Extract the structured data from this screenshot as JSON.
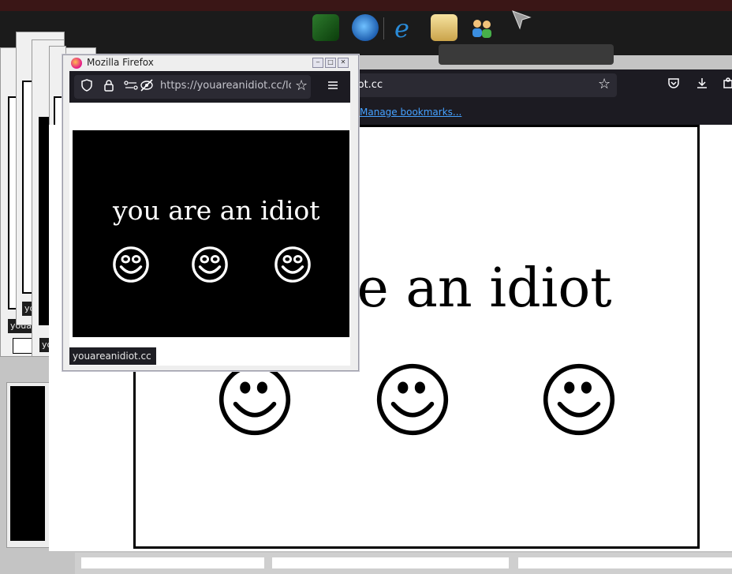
{
  "desktop": {
    "taskbar_icons": [
      "games-icon",
      "windows-update-icon",
      "internet-explorer-icon",
      "folder-mail-icon",
      "users-icon"
    ]
  },
  "background_window": {
    "url_fragment": "iot.cc",
    "bookmarks_link": "Manage bookmarks...",
    "page_text": "re an idiot",
    "smiley_count": 3
  },
  "stacked_windows": {
    "labels": [
      "you",
      "youar",
      "youa"
    ]
  },
  "popup": {
    "title": "Mozilla Firefox",
    "url": "https://youareanidiot.cc/lol.",
    "page_text": "you are an idiot",
    "status_text": "youareanidiot.cc",
    "smiley_count": 3
  },
  "colors": {
    "firefox_toolbar": "#1c1b22",
    "urlbar": "#2b2a33",
    "link": "#45a1ff"
  }
}
